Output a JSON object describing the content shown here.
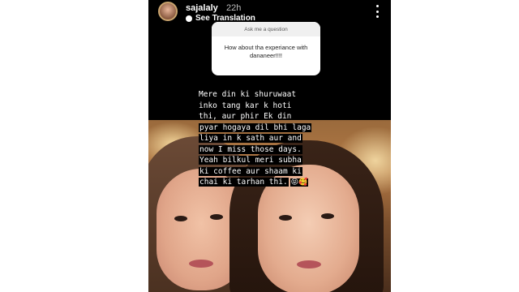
{
  "story": {
    "username": "sajalaly",
    "time": "22h",
    "see_translation": "See Translation"
  },
  "question_sticker": {
    "header": "Ask me a question",
    "question": "How about tha experiance with dananeer!!!!"
  },
  "caption": {
    "lines": [
      "Mere din ki shuruwaat",
      "inko tang kar k hoti",
      "thi, aur phir Ek din",
      "pyar hogaya dil bhi laga",
      "liya in k sath aur and",
      "now I miss those days.",
      "Yeah bilkul meri subha",
      "ki coffee aur shaam ki",
      "chai ki tarhan thi."
    ],
    "emojis": "😝🥰"
  },
  "icons": {
    "avatar": "avatar",
    "translate": "translate-icon",
    "menu": "more-options-icon"
  }
}
